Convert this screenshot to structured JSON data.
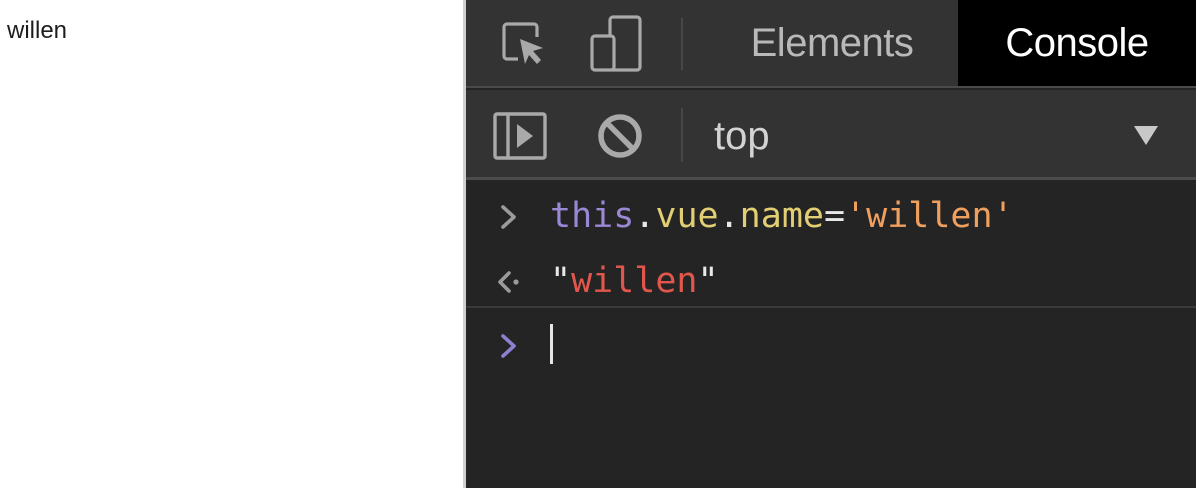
{
  "viewport": {
    "text": "willen"
  },
  "devtools": {
    "tabs": [
      {
        "label": "Elements",
        "active": false
      },
      {
        "label": "Console",
        "active": true
      }
    ],
    "toolbar_icons": {
      "inspect": "inspect-element-icon",
      "device": "device-toolbar-icon",
      "sidebar": "show-console-sidebar-icon",
      "clear": "clear-console-icon",
      "dropdown": "dropdown-arrow-icon"
    },
    "context": {
      "label": "top"
    },
    "console": {
      "input_1": {
        "kw": "this",
        "dot1": ".",
        "prop1": "vue",
        "dot2": ".",
        "prop2": "name",
        "eq": "=",
        "str": "'willen'"
      },
      "result_1": {
        "open_quote": "\"",
        "value": "willen",
        "close_quote": "\""
      },
      "prompt_value": ""
    },
    "colors": {
      "panel_bg": "#242424",
      "toolbar_bg": "#333333",
      "active_tab_bg": "#000000",
      "keyword": "#9a87d6",
      "property": "#e3cf73",
      "string": "#f0a05e",
      "result_string": "#e2574c",
      "prompt_arrow": "#9a87d6"
    }
  }
}
